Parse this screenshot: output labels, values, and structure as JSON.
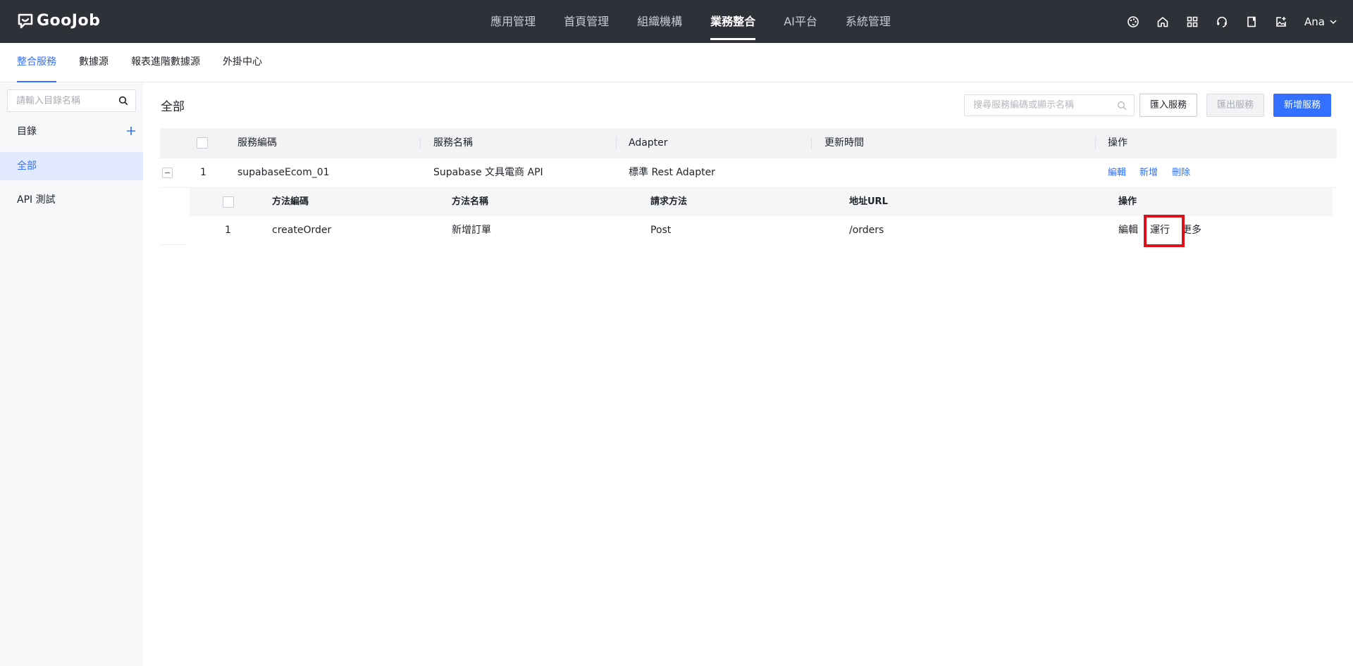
{
  "brand": {
    "logo_text": "GooJob"
  },
  "topnav": {
    "items": [
      {
        "label": "應用管理",
        "active": false
      },
      {
        "label": "首頁管理",
        "active": false
      },
      {
        "label": "組織機構",
        "active": false
      },
      {
        "label": "業務整合",
        "active": true
      },
      {
        "label": "AI平台",
        "active": false
      },
      {
        "label": "系統管理",
        "active": false
      }
    ]
  },
  "user": {
    "name": "Ana"
  },
  "subtabs": [
    {
      "label": "整合服務",
      "active": true
    },
    {
      "label": "數據源",
      "active": false
    },
    {
      "label": "報表進階數據源",
      "active": false
    },
    {
      "label": "外掛中心",
      "active": false
    }
  ],
  "sidebar": {
    "search_placeholder": "請輸入目錄名稱",
    "directory_label": "目錄",
    "items": [
      {
        "label": "全部",
        "active": true
      },
      {
        "label": "API 測試",
        "active": false
      }
    ]
  },
  "main": {
    "title": "全部",
    "search_placeholder": "搜尋服務編碼或顯示名稱",
    "import_label": "匯入服務",
    "export_label": "匯出服務",
    "add_label": "新增服務"
  },
  "table": {
    "headers": [
      "服務編碼",
      "服務名稱",
      "Adapter",
      "更新時間",
      "操作"
    ],
    "rows": [
      {
        "index": "1",
        "code": "supabaseEcom_01",
        "name": "Supabase 文具電商 API",
        "adapter": "標準 Rest Adapter",
        "updated": "",
        "actions": [
          "編輯",
          "新增",
          "刪除"
        ]
      }
    ]
  },
  "subtable": {
    "headers": [
      "方法編碼",
      "方法名稱",
      "請求方法",
      "地址URL",
      "操作"
    ],
    "rows": [
      {
        "index": "1",
        "code": "createOrder",
        "name": "新增訂單",
        "method": "Post",
        "url": "/orders",
        "actions": [
          "編輯",
          "運行",
          "更多"
        ]
      }
    ]
  },
  "colors": {
    "accent": "#3370ff",
    "header_bg": "#2e3138",
    "highlight": "#e0101a"
  }
}
